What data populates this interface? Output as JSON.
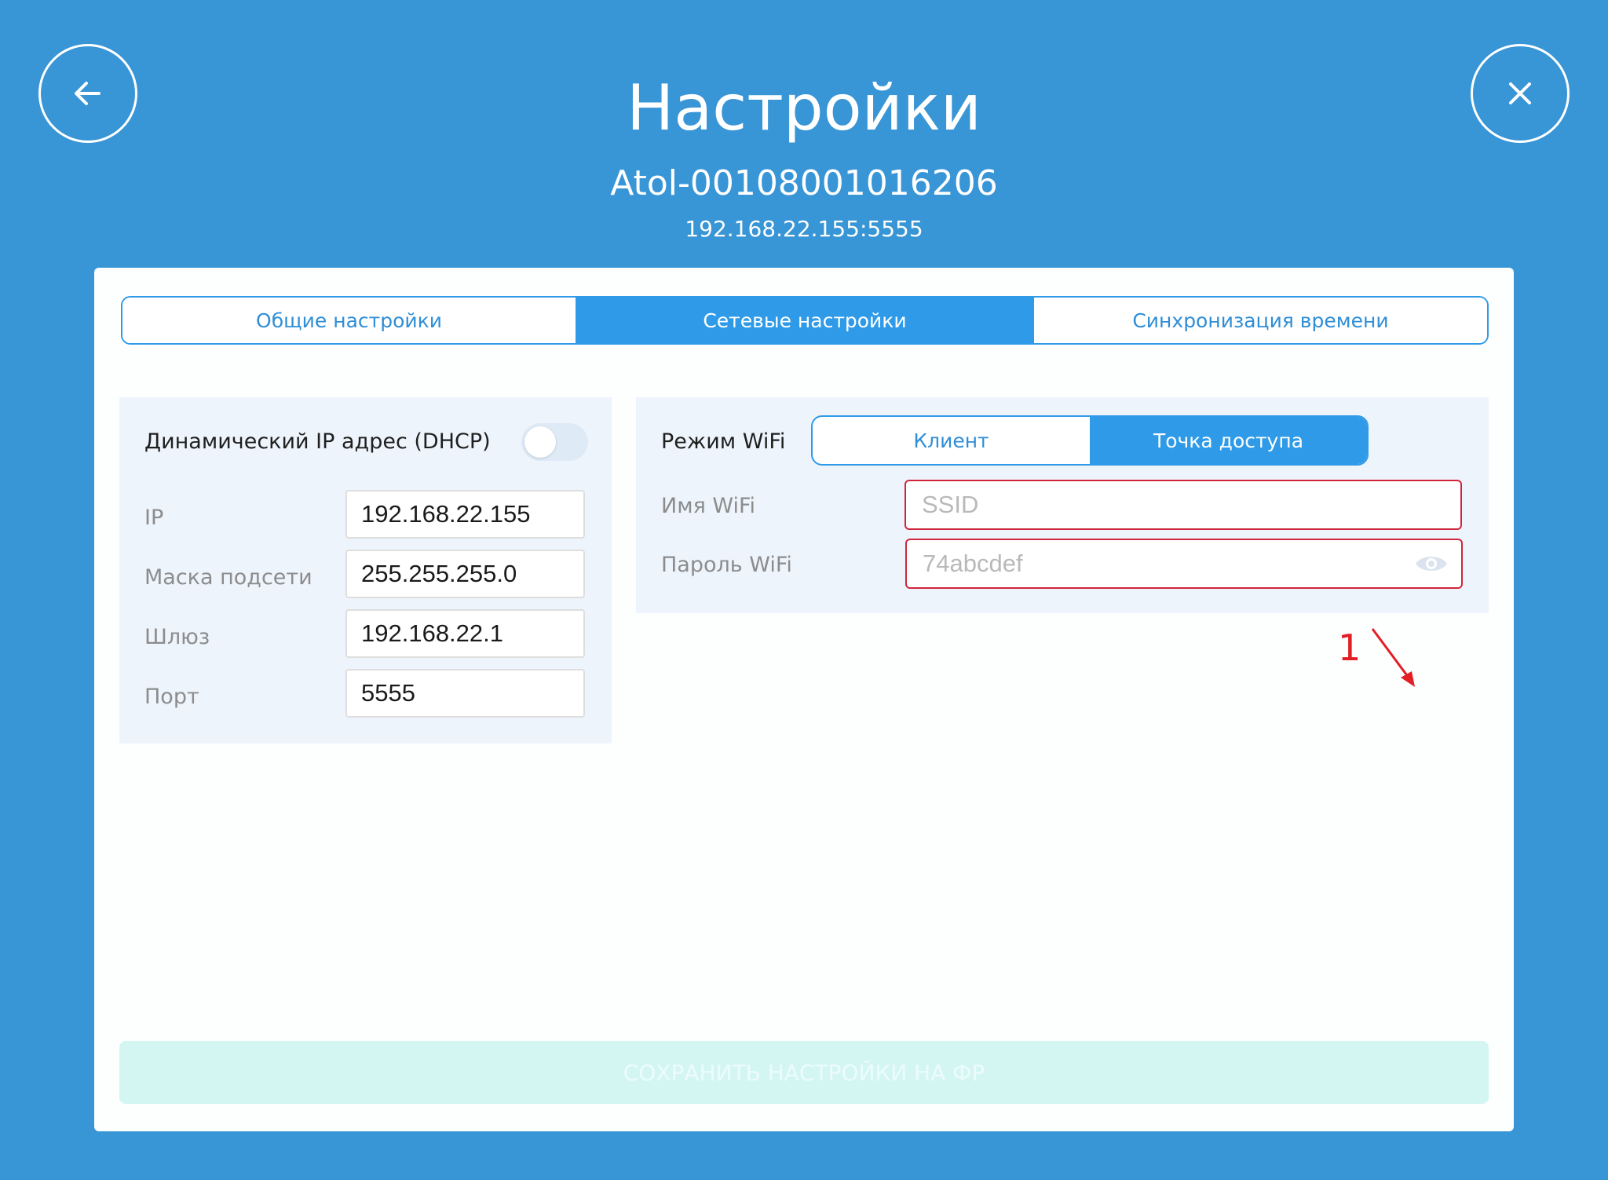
{
  "header": {
    "title": "Настройки",
    "device_name": "Atol-00108001016206",
    "address": "192.168.22.155:5555",
    "back_icon": "arrow-left-icon",
    "close_icon": "close-icon"
  },
  "tabs": [
    {
      "label": "Общие настройки",
      "active": false
    },
    {
      "label": "Сетевые настройки",
      "active": true
    },
    {
      "label": "Синхронизация времени",
      "active": false
    }
  ],
  "network": {
    "dhcp_label": "Динамический IP адрес (DHCP)",
    "dhcp_enabled": false,
    "ip_label": "IP",
    "ip_value": "192.168.22.155",
    "mask_label": "Маска подсети",
    "mask_value": "255.255.255.0",
    "gateway_label": "Шлюз",
    "gateway_value": "192.168.22.1",
    "port_label": "Порт",
    "port_value": "5555"
  },
  "wifi": {
    "mode_label": "Режим WiFi",
    "mode_client": "Клиент",
    "mode_ap": "Точка доступа",
    "selected_mode": "Точка доступа",
    "name_label": "Имя WiFi",
    "name_placeholder": "SSID",
    "name_value": "",
    "password_label": "Пароль WiFi",
    "password_placeholder": "74abcdef",
    "password_value": "",
    "eye_icon": "eye-icon"
  },
  "annotation": {
    "number": "1"
  },
  "save_button": "СОХРАНИТЬ НАСТРОЙКИ НА ФР",
  "colors": {
    "background": "#3895d6",
    "accent": "#2f9be8",
    "error_border": "#d0263b",
    "panel": "#eef4fc",
    "save_disabled": "#d4f6f2",
    "annotation": "#e31e24"
  }
}
